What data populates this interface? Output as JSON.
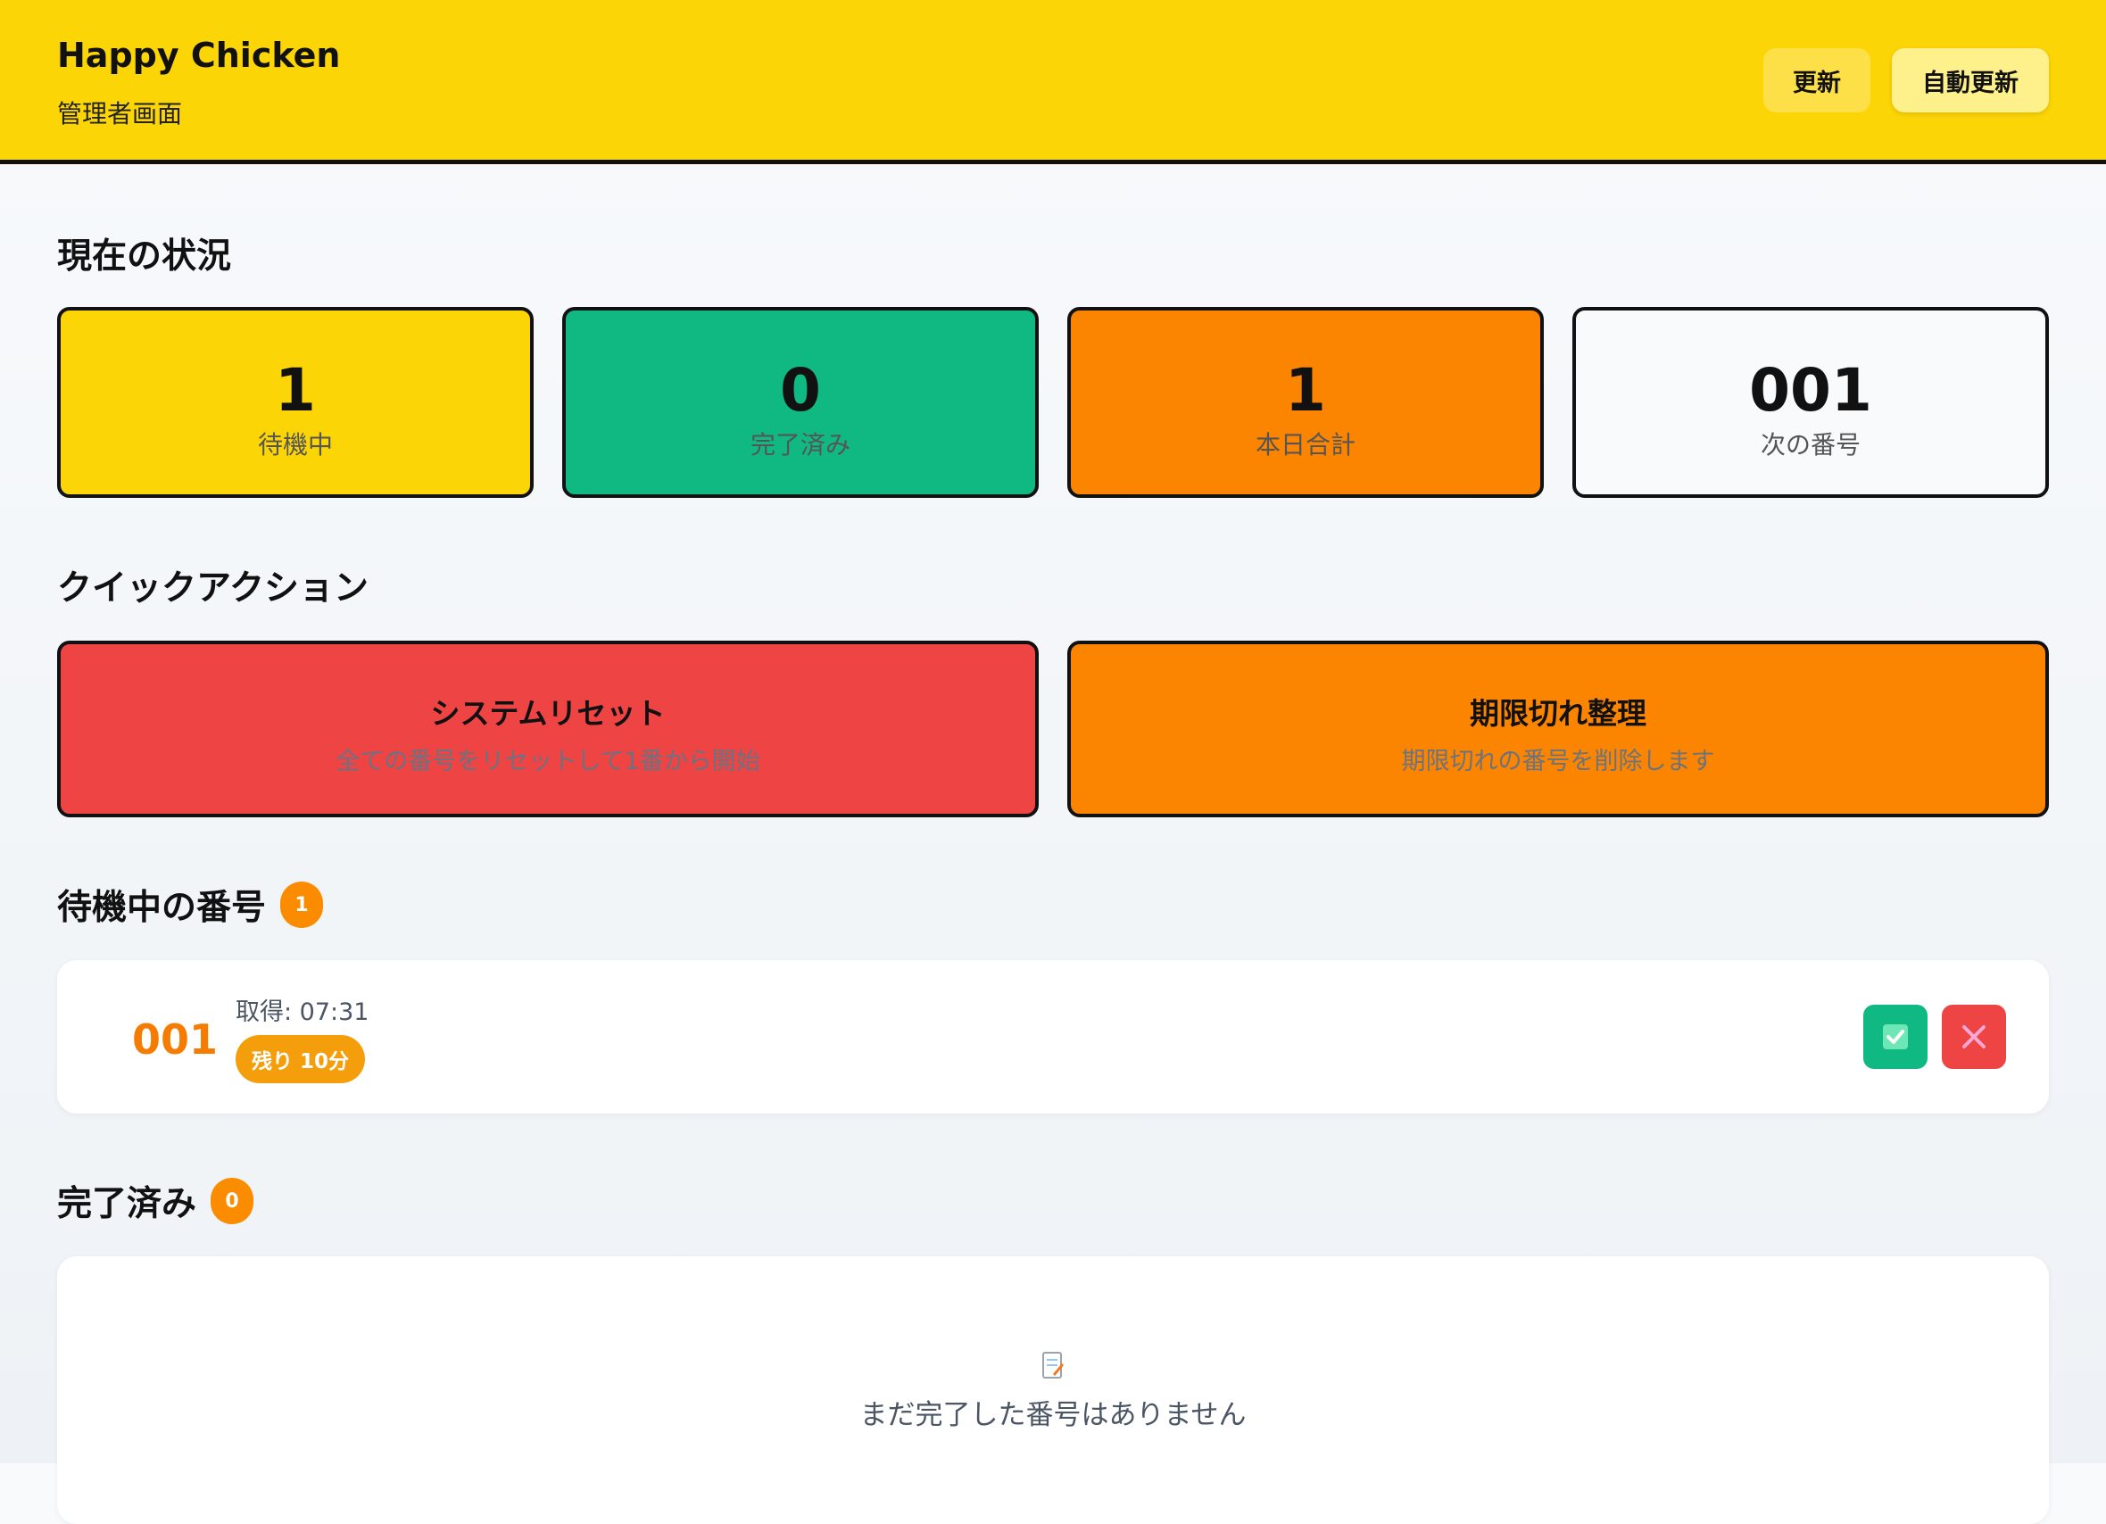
{
  "header": {
    "title": "Happy Chicken",
    "subtitle": "管理者画面",
    "refresh_label": "更新",
    "auto_refresh_label": "自動更新"
  },
  "status": {
    "title": "現在の状況",
    "cards": [
      {
        "value": "1",
        "label": "待機中",
        "color": "#fcd507"
      },
      {
        "value": "0",
        "label": "完了済み",
        "color": "#10b981"
      },
      {
        "value": "1",
        "label": "本日合計",
        "color": "#fb8500"
      },
      {
        "value": "001",
        "label": "次の番号",
        "color": "#f8fafc"
      }
    ]
  },
  "quick_actions": {
    "title": "クイックアクション",
    "reset": {
      "title": "システムリセット",
      "desc": "全ての番号をリセットして1番から開始",
      "color": "#ef4444"
    },
    "cleanup": {
      "title": "期限切れ整理",
      "desc": "期限切れの番号を削除します",
      "color": "#fb8500"
    }
  },
  "waiting": {
    "title": "待機中の番号",
    "count": "1",
    "items": [
      {
        "number": "001",
        "time": "取得: 07:31",
        "remaining": "残り 10分"
      }
    ]
  },
  "completed": {
    "title": "完了済み",
    "count": "0",
    "empty_text": "まだ完了した番号はありません"
  },
  "icons": {
    "complete": "check-icon",
    "cancel": "close-icon",
    "empty": "memo-icon"
  }
}
